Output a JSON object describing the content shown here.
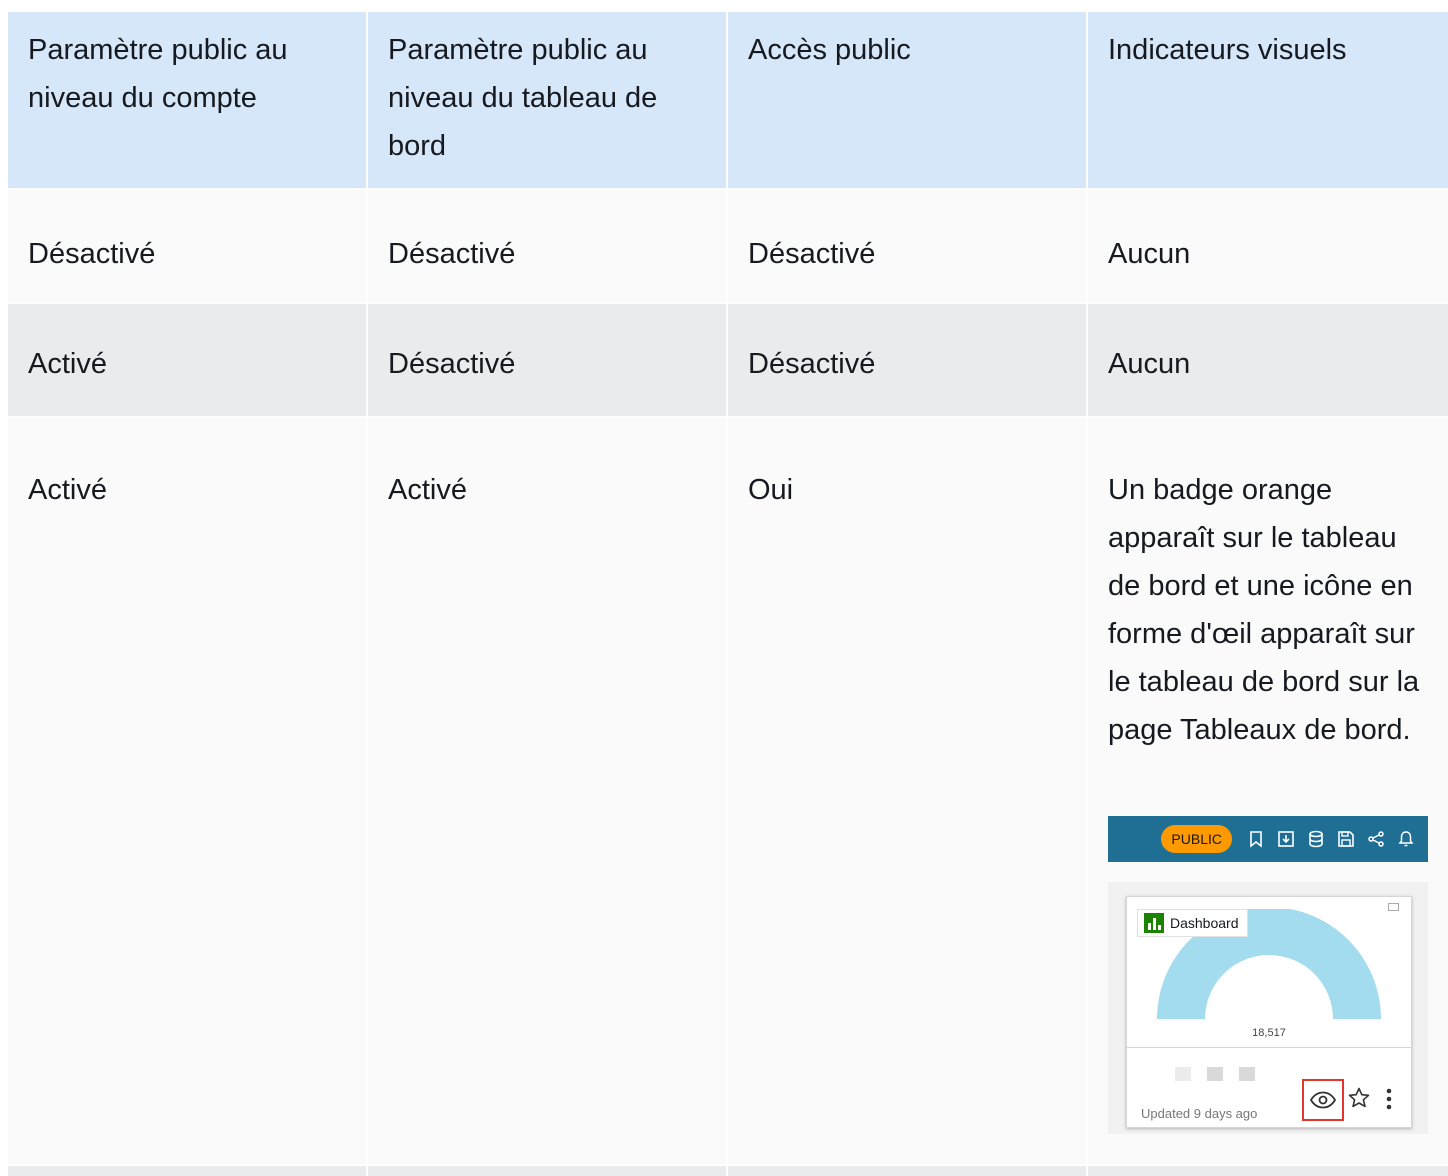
{
  "headers": [
    "Paramètre public au niveau du compte",
    "Paramètre public au niveau du tableau de bord",
    "Accès public",
    "Indicateurs visuels"
  ],
  "rows": [
    [
      "Désactivé",
      "Désactivé",
      "Désactivé",
      "Aucun"
    ],
    [
      "Activé",
      "Désactivé",
      "Désactivé",
      "Aucun"
    ],
    [
      "Activé",
      "Activé",
      "Oui",
      "Un badge orange apparaît sur le tableau de bord et une icône en forme d'œil apparaît sur le tableau de bord sur la page Tableaux de bord."
    ]
  ],
  "toolbar": {
    "badge": "PUBLIC",
    "icons": [
      "bookmark-icon",
      "download-icon",
      "database-icon",
      "save-icon",
      "share-icon",
      "bell-icon"
    ]
  },
  "dashboard_card": {
    "title": "Dashboard",
    "gauge_value": "18,517",
    "updated": "Updated 9 days ago",
    "icons": [
      "eye-icon",
      "star-icon",
      "more-icon"
    ]
  },
  "colors": {
    "header_bg": "#d5e7f8",
    "badge": "#ff9900",
    "toolbar": "#1f6e94",
    "gauge": "#a3dbef",
    "highlight": "#e0362c"
  }
}
